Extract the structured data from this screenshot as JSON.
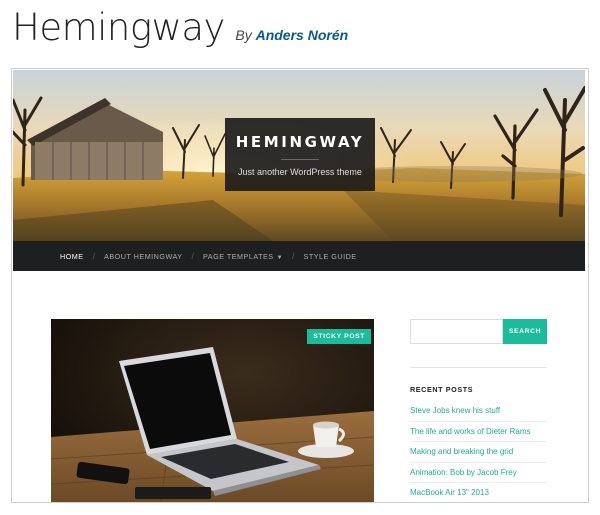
{
  "header": {
    "title": "Hemingway",
    "by_prefix": "By",
    "author": "Anders Norén"
  },
  "site": {
    "title": "HEMINGWAY",
    "tagline": "Just another WordPress theme"
  },
  "nav": {
    "items": [
      {
        "label": "Home",
        "active": true
      },
      {
        "label": "About Hemingway"
      },
      {
        "label": "Page Templates",
        "has_dropdown": true
      },
      {
        "label": "Style Guide"
      }
    ]
  },
  "post": {
    "badge": "Sticky post"
  },
  "sidebar": {
    "search_placeholder": "",
    "search_button": "Search",
    "recent_title": "Recent Posts",
    "recent_posts": [
      "Steve Jobs knew his stuff",
      "The life and works of Dieter Rams",
      "Making and breaking the grid",
      "Animation: Bob by Jacob Frey",
      "MacBook Air 13\" 2013"
    ]
  },
  "colors": {
    "accent": "#1abc9c",
    "nav_bg": "#1d1f20",
    "author_link": "#0a5a8c"
  },
  "icons": {
    "dropdown": "chevron-down-icon"
  }
}
